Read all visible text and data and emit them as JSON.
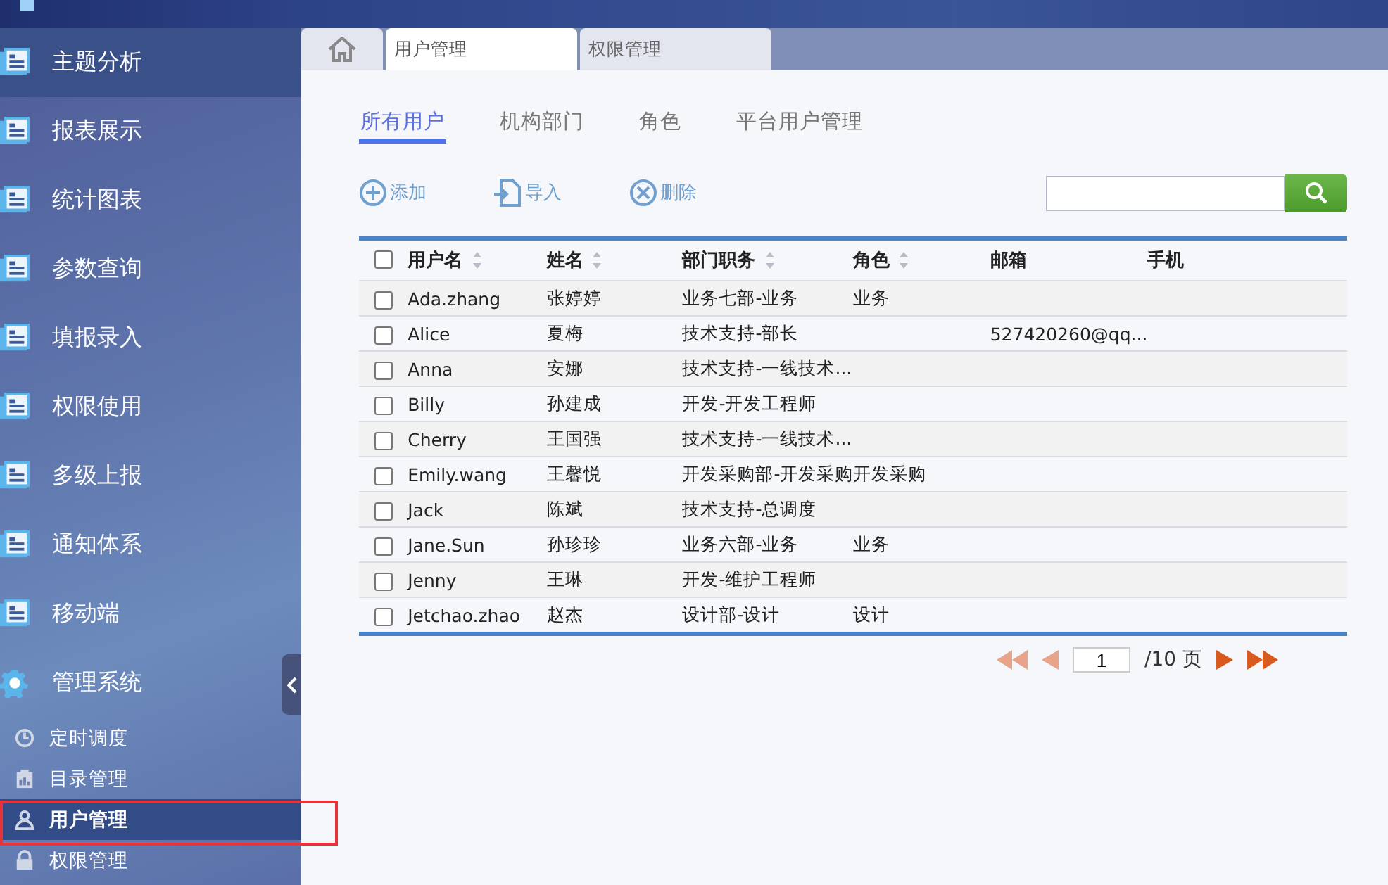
{
  "sidebar": {
    "items": [
      {
        "label": "主题分析",
        "kind": "module",
        "selected": true
      },
      {
        "label": "报表展示",
        "kind": "module",
        "selected": false
      },
      {
        "label": "统计图表",
        "kind": "module",
        "selected": false
      },
      {
        "label": "参数查询",
        "kind": "module",
        "selected": false
      },
      {
        "label": "填报录入",
        "kind": "module",
        "selected": false
      },
      {
        "label": "权限使用",
        "kind": "module",
        "selected": false
      },
      {
        "label": "多级上报",
        "kind": "module",
        "selected": false
      },
      {
        "label": "通知体系",
        "kind": "module",
        "selected": false
      },
      {
        "label": "移动端",
        "kind": "module",
        "selected": false
      },
      {
        "label": "管理系统",
        "kind": "settings",
        "selected": false
      }
    ],
    "subitems": [
      {
        "label": "定时调度",
        "kind": "clock",
        "selected": false,
        "highlighted": false
      },
      {
        "label": "目录管理",
        "kind": "catalog",
        "selected": false,
        "highlighted": false
      },
      {
        "label": "用户管理",
        "kind": "user",
        "selected": true,
        "highlighted": true
      },
      {
        "label": "权限管理",
        "kind": "lock",
        "selected": false,
        "highlighted": false
      }
    ]
  },
  "tabs": [
    {
      "kind": "home",
      "selected": false
    },
    {
      "kind": "page",
      "label": "用户管理",
      "selected": true
    },
    {
      "kind": "page",
      "label": "权限管理",
      "selected": false
    }
  ],
  "subtabs": [
    {
      "label": "所有用户",
      "selected": true
    },
    {
      "label": "机构部门",
      "selected": false
    },
    {
      "label": "角色",
      "selected": false
    },
    {
      "label": "平台用户管理",
      "selected": false
    }
  ],
  "toolbar": [
    {
      "label": "添加",
      "kind": "add"
    },
    {
      "label": "导入",
      "kind": "import"
    },
    {
      "label": "删除",
      "kind": "delete"
    }
  ],
  "table": {
    "header_checked": false,
    "columns": [
      {
        "label": "用户名",
        "sortable": true
      },
      {
        "label": "姓名",
        "sortable": true
      },
      {
        "label": "部门职务",
        "sortable": true
      },
      {
        "label": "角色",
        "sortable": true
      },
      {
        "label": "邮箱",
        "sortable": false
      },
      {
        "label": "手机",
        "sortable": false
      }
    ],
    "rows": [
      {
        "checked": false,
        "cells": [
          "Ada.zhang",
          "张婷婷",
          "业务七部-业务",
          "业务",
          "",
          ""
        ]
      },
      {
        "checked": false,
        "cells": [
          "Alice",
          "夏梅",
          "技术支持-部长",
          "",
          "527420260@qq...",
          ""
        ]
      },
      {
        "checked": false,
        "cells": [
          "Anna",
          "安娜",
          "技术支持-一线技术...",
          "",
          "",
          ""
        ]
      },
      {
        "checked": false,
        "cells": [
          "Billy",
          "孙建成",
          "开发-开发工程师",
          "",
          "",
          ""
        ]
      },
      {
        "checked": false,
        "cells": [
          "Cherry",
          "王国强",
          "技术支持-一线技术...",
          "",
          "",
          ""
        ]
      },
      {
        "checked": false,
        "cells": [
          "Emily.wang",
          "王馨悦",
          "开发采购部-开发采购",
          "开发采购",
          "",
          ""
        ]
      },
      {
        "checked": false,
        "cells": [
          "Jack",
          "陈斌",
          "技术支持-总调度",
          "",
          "",
          ""
        ]
      },
      {
        "checked": false,
        "cells": [
          "Jane.Sun",
          "孙珍珍",
          "业务六部-业务",
          "业务",
          "",
          ""
        ]
      },
      {
        "checked": false,
        "cells": [
          "Jenny",
          "王琳",
          "开发-维护工程师",
          "",
          "",
          ""
        ]
      },
      {
        "checked": false,
        "cells": [
          "Jetchao.zhao",
          "赵杰",
          "设计部-设计",
          "设计",
          "",
          ""
        ]
      }
    ]
  },
  "pagination": {
    "page": "1",
    "total": "/10 页"
  }
}
